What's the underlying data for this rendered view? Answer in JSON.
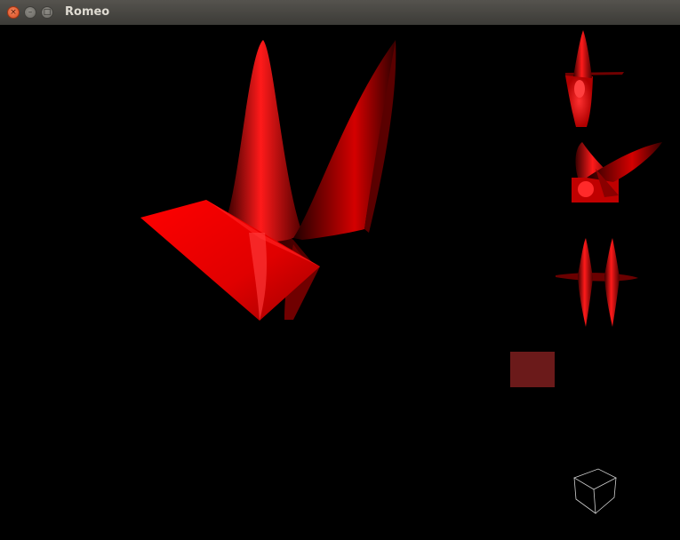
{
  "window": {
    "title": "Romeo",
    "buttons": {
      "close": "×",
      "minimize": "–",
      "maximize": "□"
    }
  },
  "scene": {
    "mesh_color": "#e00000",
    "swatch_color": "#6b1a1a",
    "background": "#000000",
    "views": [
      "main-surface",
      "thumbnail-front",
      "thumbnail-perspective",
      "thumbnail-side",
      "color-swatch",
      "orientation-cube"
    ]
  }
}
